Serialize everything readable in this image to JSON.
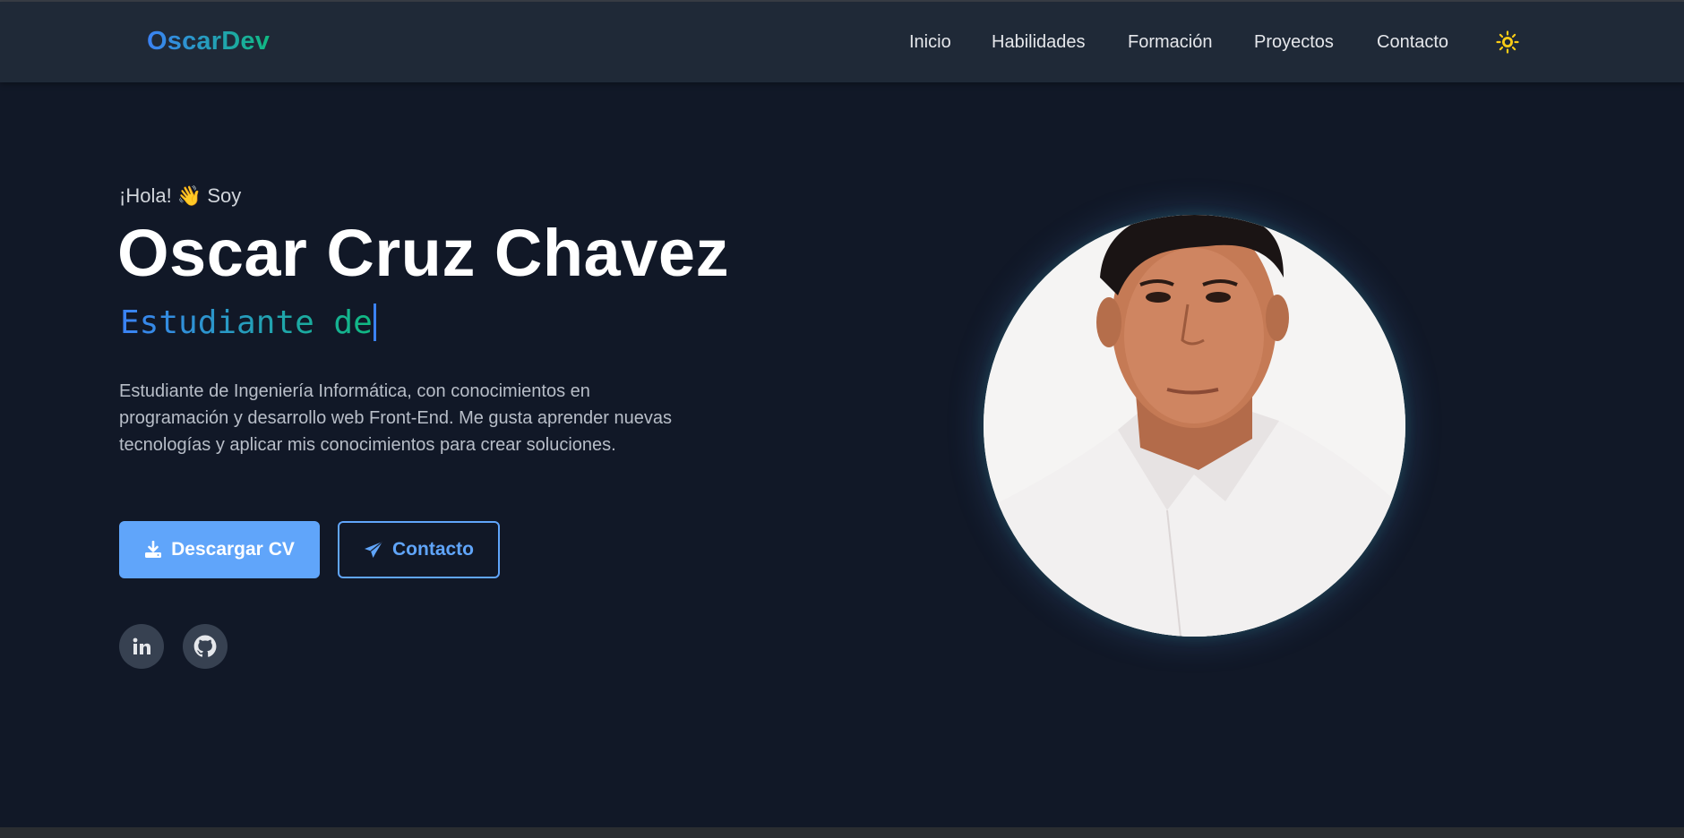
{
  "navbar": {
    "logo": "OscarDev",
    "links": [
      "Inicio",
      "Habilidades",
      "Formación",
      "Proyectos",
      "Contacto"
    ],
    "theme_icon": "sun-icon"
  },
  "hero": {
    "greeting_pre": "¡Hola!",
    "greeting_emoji": "👋",
    "greeting_post": "Soy",
    "name": "Oscar Cruz Chavez",
    "typed_text": "Estudiante de",
    "bio": "Estudiante de Ingeniería Informática, con conocimientos en programación y desarrollo web Front-End. Me gusta aprender nuevas tecnologías y aplicar mis conocimientos para crear soluciones.",
    "buttons": {
      "download_label": "Descargar CV",
      "download_icon": "download-icon",
      "contact_label": "Contacto",
      "contact_icon": "paper-plane-icon"
    },
    "social": [
      "linkedin-icon",
      "github-icon"
    ],
    "photo": "profile-photo"
  },
  "colors": {
    "background": "#111827",
    "navbar": "#1f2937",
    "accent_blue": "#60a5fa",
    "gradient_start": "#3b82f6",
    "gradient_end": "#10b981",
    "sun": "#facc15"
  }
}
